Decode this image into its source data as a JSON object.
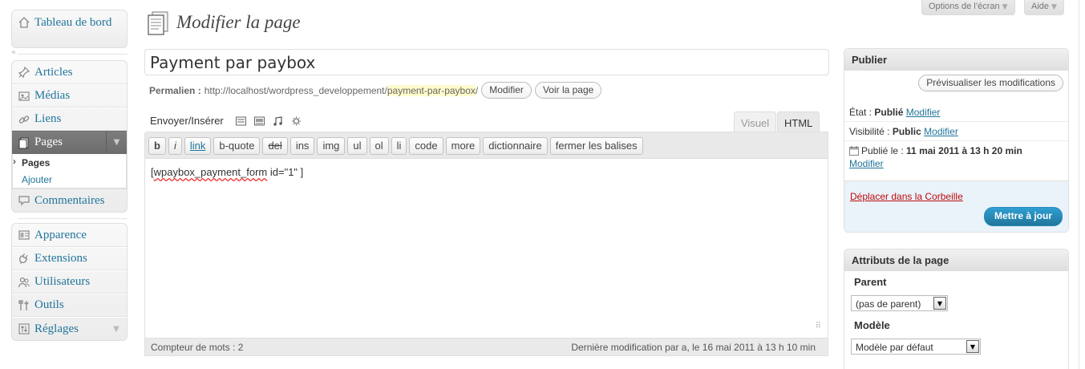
{
  "header": {
    "title": "Modifier la page",
    "screen_options": "Options de l’écran",
    "help": "Aide"
  },
  "sidebar": {
    "dashboard": "Tableau de bord",
    "articles": "Articles",
    "medias": "Médias",
    "liens": "Liens",
    "pages": "Pages",
    "pages_sub": [
      "Pages",
      "Ajouter"
    ],
    "commentaires": "Commentaires",
    "apparence": "Apparence",
    "extensions": "Extensions",
    "utilisateurs": "Utilisateurs",
    "outils": "Outils",
    "reglages": "Réglages"
  },
  "post": {
    "title": "Payment par paybox",
    "permalink_label": "Permalien :",
    "permalink_base": "http://localhost/wordpress_developpement/",
    "permalink_slug": "payment-par-paybox",
    "permalink_end": "/",
    "modify_btn": "Modifier",
    "view_btn": "Voir la page"
  },
  "editor": {
    "upload_label": "Envoyer/Insérer",
    "tab_visual": "Visuel",
    "tab_html": "HTML",
    "quicktags": [
      "b",
      "i",
      "link",
      "b-quote",
      "del",
      "ins",
      "img",
      "ul",
      "ol",
      "li",
      "code",
      "more",
      "dictionnaire",
      "fermer les balises"
    ],
    "content_open": "[",
    "content_spell": "wpaybox_payment_form",
    "content_rest": " id=\"1\" ]",
    "word_count": "Compteur de mots : 2",
    "last_modified": "Dernière modification par a, le 16 mai 2011 à 13 h 10 min"
  },
  "publish": {
    "heading": "Publier",
    "preview_btn": "Prévisualiser les modifications",
    "status_label": "État :",
    "status_value": "Publié",
    "visibility_label": "Visibilité :",
    "visibility_value": "Public",
    "published_label": "Publié le :",
    "published_value": "11 mai 2011 à 13 h 20 min",
    "modify_link": "Modifier",
    "trash_link": "Déplacer dans la Corbeille",
    "update_btn": "Mettre à jour"
  },
  "attributes": {
    "heading": "Attributs de la page",
    "parent_label": "Parent",
    "parent_value": "(pas de parent)",
    "template_label": "Modèle",
    "template_value": "Modèle par défaut"
  },
  "colors": {
    "link": "#21759b",
    "update_button": "#21759b",
    "trash": "#bc0b0b",
    "slug_highlight": "#fffbcc"
  }
}
